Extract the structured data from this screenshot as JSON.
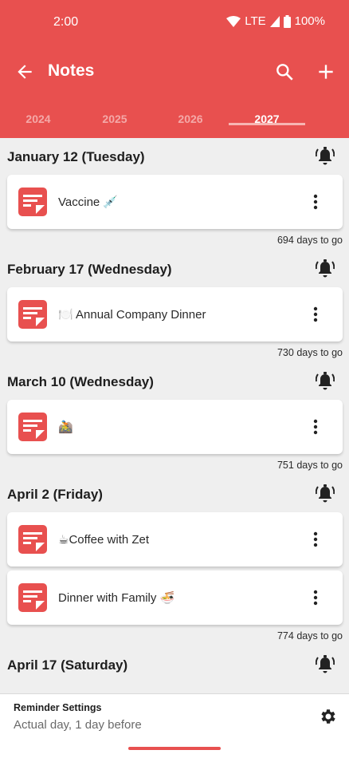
{
  "status_bar": {
    "time": "2:00",
    "network": "LTE",
    "battery": "100%"
  },
  "toolbar": {
    "title": "Notes"
  },
  "tabs": [
    {
      "label": "2024",
      "active": false
    },
    {
      "label": "2025",
      "active": false
    },
    {
      "label": "2026",
      "active": false
    },
    {
      "label": "2027",
      "active": true
    }
  ],
  "groups": [
    {
      "date": "January 12 (Tuesday)",
      "notes": [
        "Vaccine 💉"
      ],
      "days_to_go": "694 days to go"
    },
    {
      "date": "February 17 (Wednesday)",
      "notes": [
        "🍽️ Annual Company Dinner"
      ],
      "days_to_go": "730 days to go"
    },
    {
      "date": "March 10 (Wednesday)",
      "notes": [
        "🚵"
      ],
      "days_to_go": "751 days to go"
    },
    {
      "date": "April 2 (Friday)",
      "notes": [
        "☕Coffee with Zet",
        "Dinner with Family 🍜"
      ],
      "days_to_go": "774 days to go"
    },
    {
      "date": "April 17 (Saturday)",
      "notes": [],
      "days_to_go": ""
    }
  ],
  "reminder_settings": {
    "title": "Reminder Settings",
    "value": "Actual day, 1 day before"
  },
  "colors": {
    "accent": "#e8504f",
    "tab_indicator": "#f7b5b2",
    "background": "#efefef"
  }
}
